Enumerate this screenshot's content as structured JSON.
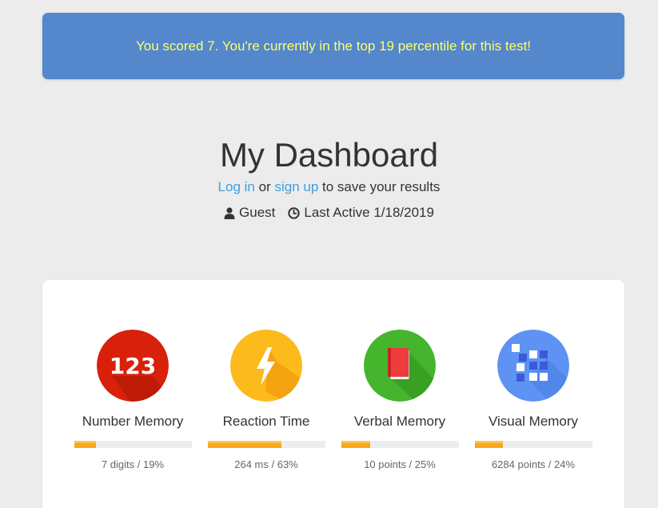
{
  "banner": {
    "message": "You scored 7. You're currently in the top 19 percentile for this test!"
  },
  "header": {
    "title": "My Dashboard",
    "login_label": "Log in",
    "or_text": "or",
    "signup_label": "sign up",
    "save_text": "to save your results",
    "user_icon": "user-icon",
    "username": "Guest",
    "clock_icon": "clock-icon",
    "last_active": "Last Active 1/18/2019"
  },
  "tests": [
    {
      "name": "Number Memory",
      "icon": "number-123-icon",
      "score": "7 digits / 19%",
      "percentile": 19,
      "color": "#d9200a"
    },
    {
      "name": "Reaction Time",
      "icon": "lightning-bolt-icon",
      "score": "264 ms / 63%",
      "percentile": 63,
      "color": "#fcba1c"
    },
    {
      "name": "Verbal Memory",
      "icon": "book-icon",
      "score": "10 points / 25%",
      "percentile": 25,
      "color": "#44b52c"
    },
    {
      "name": "Visual Memory",
      "icon": "grid-squares-icon",
      "score": "6284 points / 24%",
      "percentile": 24,
      "color": "#5e93f4"
    }
  ],
  "colors": {
    "banner_bg": "#5487cc",
    "banner_text": "#ffff66",
    "link": "#3e9fe0",
    "progress": "#f8a81c",
    "progress_track": "#ededed",
    "page_bg": "#ececec"
  }
}
